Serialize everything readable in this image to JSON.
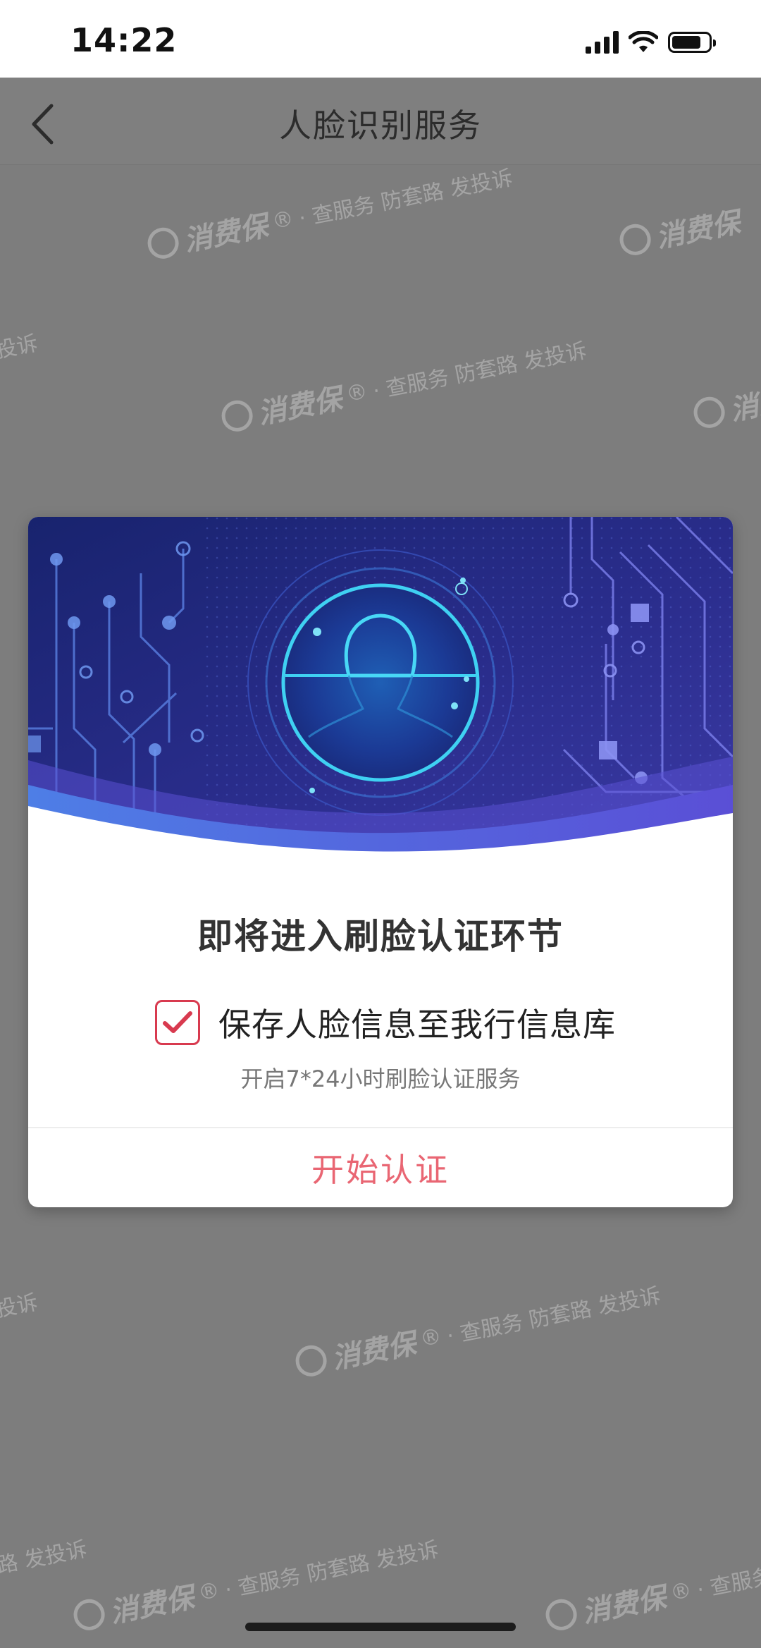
{
  "status_bar": {
    "time": "14:22",
    "icons": [
      "cellular-signal-icon",
      "wifi-icon",
      "battery-icon"
    ]
  },
  "nav": {
    "back_icon": "chevron-left-icon",
    "title": "人脸识别服务"
  },
  "watermark": {
    "brand": "消费保",
    "registered": "®",
    "tagline": "· 查服务 防套路 发投诉"
  },
  "modal": {
    "title": "即将进入刷脸认证环节",
    "checkbox": {
      "checked": true,
      "label": "保存人脸信息至我行信息库"
    },
    "subtitle": "开启7*24小时刷脸认证服务",
    "start_button": "开始认证"
  },
  "colors": {
    "accent_red": "#e96673",
    "checkbox_red": "#d83a4f",
    "hero_dark": "#1e237a",
    "hero_glow": "#3fd1f2"
  }
}
